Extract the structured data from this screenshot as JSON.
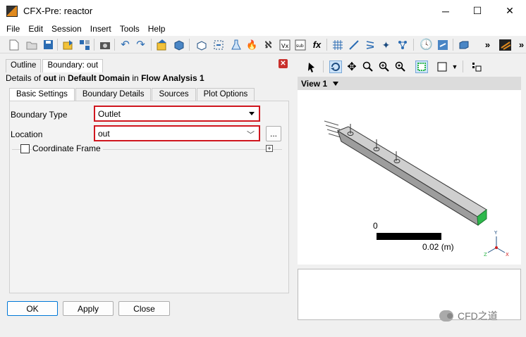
{
  "window": {
    "title": "CFX-Pre:  reactor",
    "minimize": "─",
    "maximize": "☐",
    "close": "✕"
  },
  "menu": [
    "File",
    "Edit",
    "Session",
    "Insert",
    "Tools",
    "Help"
  ],
  "panel": {
    "tabs": [
      "Outline",
      "Boundary: out"
    ],
    "close_icon": "close-icon",
    "details_prefix": "Details of ",
    "details_object": "out",
    "details_in1": " in ",
    "details_domain": "Default Domain",
    "details_in2": " in ",
    "details_analysis": "Flow Analysis 1",
    "subtabs": [
      "Basic Settings",
      "Boundary Details",
      "Sources",
      "Plot Options"
    ],
    "boundary_type_label": "Boundary Type",
    "boundary_type_value": "Outlet",
    "location_label": "Location",
    "location_value": "out",
    "location_button": "...",
    "coordinate_frame_label": "Coordinate Frame",
    "coordinate_frame_checked": false,
    "ok_button": "OK",
    "apply_button": "Apply",
    "close_button": "Close"
  },
  "viewer": {
    "view_label": "View 1",
    "scale_zero": "0",
    "scale_value": "0.02  (m)",
    "axis_labels": [
      "Y",
      "X",
      "Z"
    ],
    "outlet_color": "#2db84b"
  },
  "watermark": "CFD之道"
}
